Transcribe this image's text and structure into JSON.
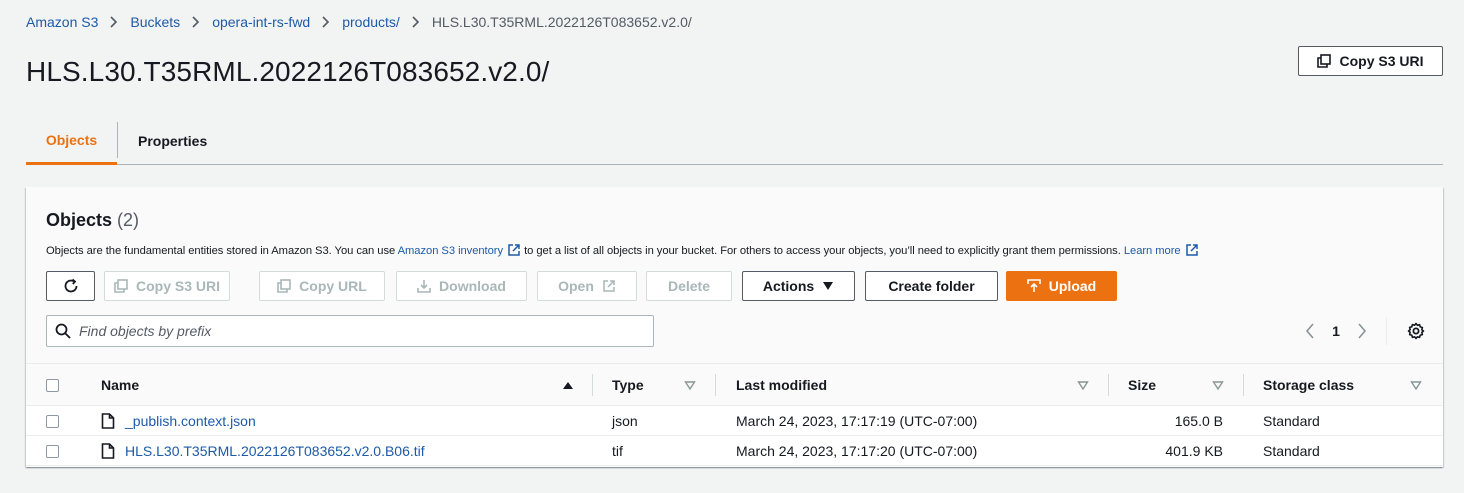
{
  "breadcrumb": {
    "items": [
      "Amazon S3",
      "Buckets",
      "opera-int-rs-fwd",
      "products/",
      "HLS.L30.T35RML.2022126T083652.v2.0/"
    ]
  },
  "header": {
    "title": "HLS.L30.T35RML.2022126T083652.v2.0/",
    "copy_uri_label": "Copy S3 URI"
  },
  "tabs": [
    {
      "label": "Objects",
      "active": true
    },
    {
      "label": "Properties",
      "active": false
    }
  ],
  "objects_panel": {
    "title": "Objects",
    "count": "(2)",
    "desc_before": "Objects are the fundamental entities stored in Amazon S3. You can use ",
    "desc_link1": "Amazon S3 inventory",
    "desc_middle": " to get a list of all objects in your bucket. For others to access your objects, you’ll need to explicitly grant them permissions. ",
    "desc_link2": "Learn more",
    "toolbar": {
      "copy_uri": "Copy S3 URI",
      "copy_url": "Copy URL",
      "download": "Download",
      "open": "Open",
      "delete": "Delete",
      "actions": "Actions",
      "create_folder": "Create folder",
      "upload": "Upload"
    },
    "search": {
      "placeholder": "Find objects by prefix",
      "value": ""
    },
    "pagination": {
      "current_page": "1"
    },
    "table": {
      "columns": [
        "Name",
        "Type",
        "Last modified",
        "Size",
        "Storage class"
      ],
      "rows": [
        {
          "name": "_publish.context.json",
          "type": "json",
          "last_modified": "March 24, 2023, 17:17:19 (UTC-07:00)",
          "size": "165.0 B",
          "storage_class": "Standard"
        },
        {
          "name": "HLS.L30.T35RML.2022126T083652.v2.0.B06.tif",
          "type": "tif",
          "last_modified": "March 24, 2023, 17:17:20 (UTC-07:00)",
          "size": "401.9 KB",
          "storage_class": "Standard"
        }
      ]
    }
  },
  "colors": {
    "accent": "#ec7211",
    "link": "#1d5aa8",
    "text": "#16191f",
    "background": "#f2f3f3",
    "disabled": "#aab7b8"
  },
  "icons": [
    "chevron-right-icon",
    "copy-icon",
    "refresh-icon",
    "download-icon",
    "external-link-icon",
    "caret-down-icon",
    "upload-icon",
    "search-icon",
    "chevron-left-icon",
    "gear-icon",
    "sort-ascending-icon",
    "sort-icon",
    "file-icon"
  ]
}
